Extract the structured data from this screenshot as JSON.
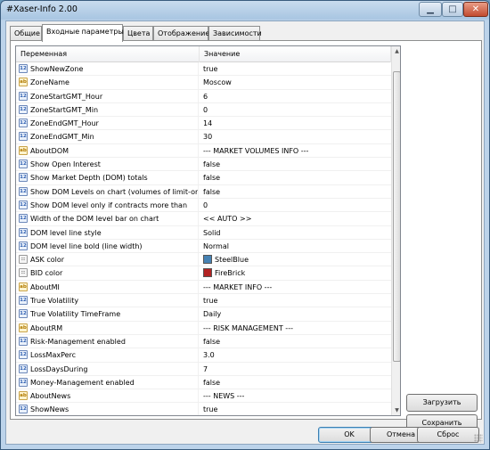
{
  "window": {
    "title": "#Xaser-Info 2.00",
    "min_glyph": "▁",
    "max_glyph": "□",
    "close_glyph": "✕"
  },
  "tabs": [
    {
      "label": "Общие",
      "active": false
    },
    {
      "label": "Входные параметры",
      "active": true
    },
    {
      "label": "Цвета",
      "active": false
    },
    {
      "label": "Отображение",
      "active": false
    },
    {
      "label": "Зависимости",
      "active": false
    }
  ],
  "grid": {
    "header": {
      "variable": "Переменная",
      "value": "Значение"
    },
    "rows": [
      {
        "type": "num",
        "icon": "12",
        "name": "ShowNewZone",
        "value": "true"
      },
      {
        "type": "str",
        "icon": "ab",
        "name": "ZoneName",
        "value": "Moscow"
      },
      {
        "type": "num",
        "icon": "12",
        "name": "ZoneStartGMT_Hour",
        "value": "6"
      },
      {
        "type": "num",
        "icon": "12",
        "name": "ZoneStartGMT_Min",
        "value": "0"
      },
      {
        "type": "num",
        "icon": "12",
        "name": "ZoneEndGMT_Hour",
        "value": "14"
      },
      {
        "type": "num",
        "icon": "12",
        "name": "ZoneEndGMT_Min",
        "value": "30"
      },
      {
        "type": "str",
        "icon": "ab",
        "name": "AboutDOM",
        "value": "--- MARKET VOLUMES INFO ---"
      },
      {
        "type": "num",
        "icon": "12",
        "name": "Show Open Interest",
        "value": "false"
      },
      {
        "type": "num",
        "icon": "12",
        "name": "Show Market Depth (DOM) totals",
        "value": "false"
      },
      {
        "type": "num",
        "icon": "12",
        "name": "Show DOM Levels on chart (volumes of limit-orders)",
        "value": "false"
      },
      {
        "type": "num",
        "icon": "12",
        "name": "Show DOM level only if contracts more than",
        "value": "0"
      },
      {
        "type": "num",
        "icon": "12",
        "name": "Width of the DOM level bar on chart",
        "value": "<< AUTO >>"
      },
      {
        "type": "num",
        "icon": "12",
        "name": "DOM level line style",
        "value": "Solid"
      },
      {
        "type": "num",
        "icon": "12",
        "name": "DOM level line bold (line width)",
        "value": "Normal"
      },
      {
        "type": "clr",
        "icon": "::",
        "name": "ASK color",
        "value": "SteelBlue",
        "swatch": "#4682b4"
      },
      {
        "type": "clr",
        "icon": "::",
        "name": "BID color",
        "value": "FireBrick",
        "swatch": "#b22222"
      },
      {
        "type": "str",
        "icon": "ab",
        "name": "AboutMI",
        "value": "--- MARKET INFO ---"
      },
      {
        "type": "num",
        "icon": "12",
        "name": "True Volatility",
        "value": "true"
      },
      {
        "type": "num",
        "icon": "12",
        "name": "True Volatility TimeFrame",
        "value": "Daily"
      },
      {
        "type": "str",
        "icon": "ab",
        "name": "AboutRM",
        "value": "--- RISK MANAGEMENT ---"
      },
      {
        "type": "num",
        "icon": "12",
        "name": "Risk-Management enabled",
        "value": "false"
      },
      {
        "type": "num",
        "icon": "12",
        "name": "LossMaxPerc",
        "value": "3.0"
      },
      {
        "type": "num",
        "icon": "12",
        "name": "LossDaysDuring",
        "value": "7"
      },
      {
        "type": "num",
        "icon": "12",
        "name": "Money-Management enabled",
        "value": "false"
      },
      {
        "type": "str",
        "icon": "ab",
        "name": "AboutNews",
        "value": "--- NEWS ---"
      },
      {
        "type": "num",
        "icon": "12",
        "name": "ShowNews",
        "value": "true"
      }
    ]
  },
  "scroll": {
    "up_glyph": "▲",
    "down_glyph": "▼"
  },
  "side_buttons": {
    "load": "Загрузить",
    "save": "Сохранить"
  },
  "bottom_buttons": {
    "ok": "OK",
    "cancel": "Отмена",
    "reset": "Сброс"
  }
}
